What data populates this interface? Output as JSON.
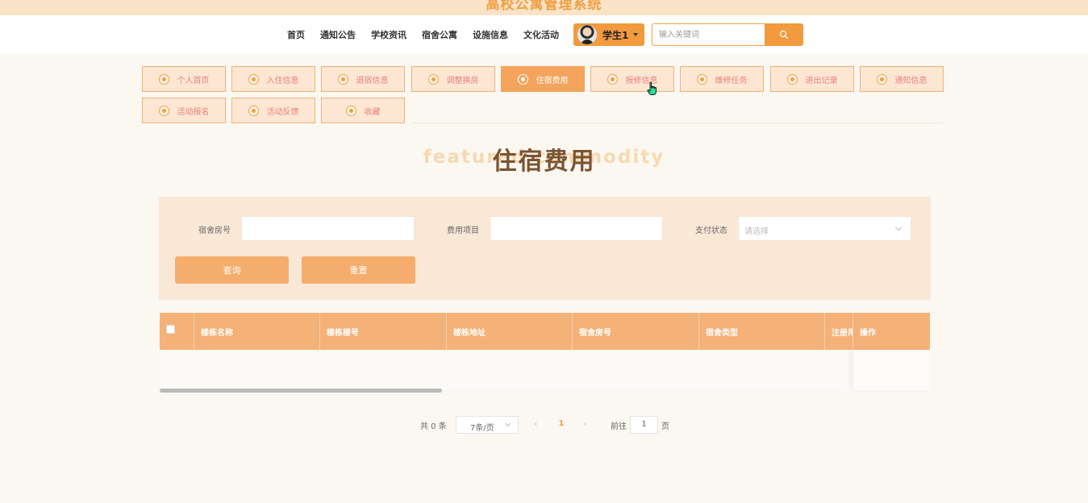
{
  "site": {
    "title": "高校公寓管理系统"
  },
  "nav": {
    "links": [
      "首页",
      "通知公告",
      "学校资讯",
      "宿舍公寓",
      "设施信息",
      "文化活动"
    ],
    "user_name": "学生1",
    "search_placeholder": "输入关键词",
    "search_icon": "search-icon"
  },
  "menu": {
    "items": [
      "个人首页",
      "入住信息",
      "退宿信息",
      "调整换房",
      "住宿费用",
      "报修信息",
      "维修任务",
      "进出记录",
      "通知信息",
      "活动报名",
      "活动反馈",
      "收藏"
    ],
    "active": "住宿费用"
  },
  "page": {
    "heading": "住宿费用",
    "heading_bg": "featured commodity"
  },
  "filters": {
    "room_label": "宿舍房号",
    "fee_label": "费用项目",
    "status_label": "支付状态",
    "status_placeholder": "请选择",
    "query_button": "查询",
    "reset_button": "重置"
  },
  "table": {
    "columns": [
      "楼栋名称",
      "楼栋楼号",
      "楼栋地址",
      "宿舍房号",
      "宿舍类型",
      "注册用户",
      "操作"
    ]
  },
  "pagination": {
    "total": "共 0 条",
    "page_size": "7条/页",
    "prev": "‹",
    "current": "1",
    "next": "›",
    "goto_label": "前往",
    "goto_value": "1",
    "unit": "页"
  },
  "colors": {
    "accent": "#f19a3e",
    "menu_bg": "#fde7d2",
    "table_header": "#f4b178",
    "heading": "#7a5532"
  }
}
